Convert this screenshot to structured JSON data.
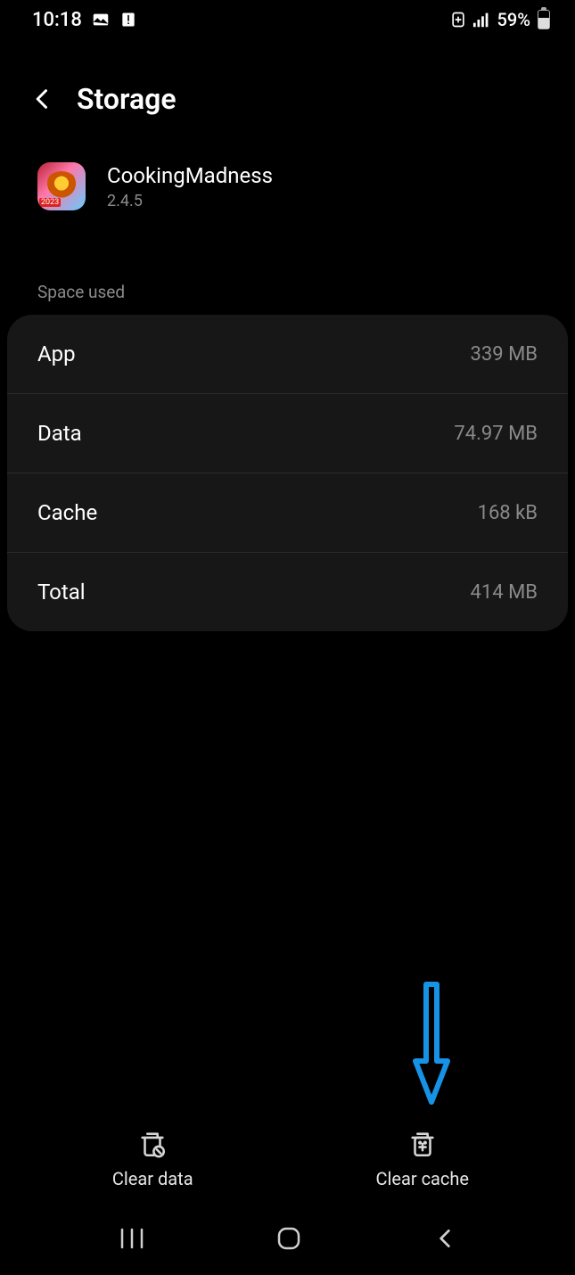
{
  "status": {
    "time": "10:18",
    "battery_pct": "59%"
  },
  "header": {
    "title": "Storage"
  },
  "app": {
    "name": "CookingMadness",
    "version": "2.4.5"
  },
  "section": {
    "label": "Space used"
  },
  "rows": {
    "app": {
      "label": "App",
      "value": "339 MB"
    },
    "data": {
      "label": "Data",
      "value": "74.97 MB"
    },
    "cache": {
      "label": "Cache",
      "value": "168 kB"
    },
    "total": {
      "label": "Total",
      "value": "414 MB"
    }
  },
  "actions": {
    "clear_data": "Clear data",
    "clear_cache": "Clear cache"
  }
}
